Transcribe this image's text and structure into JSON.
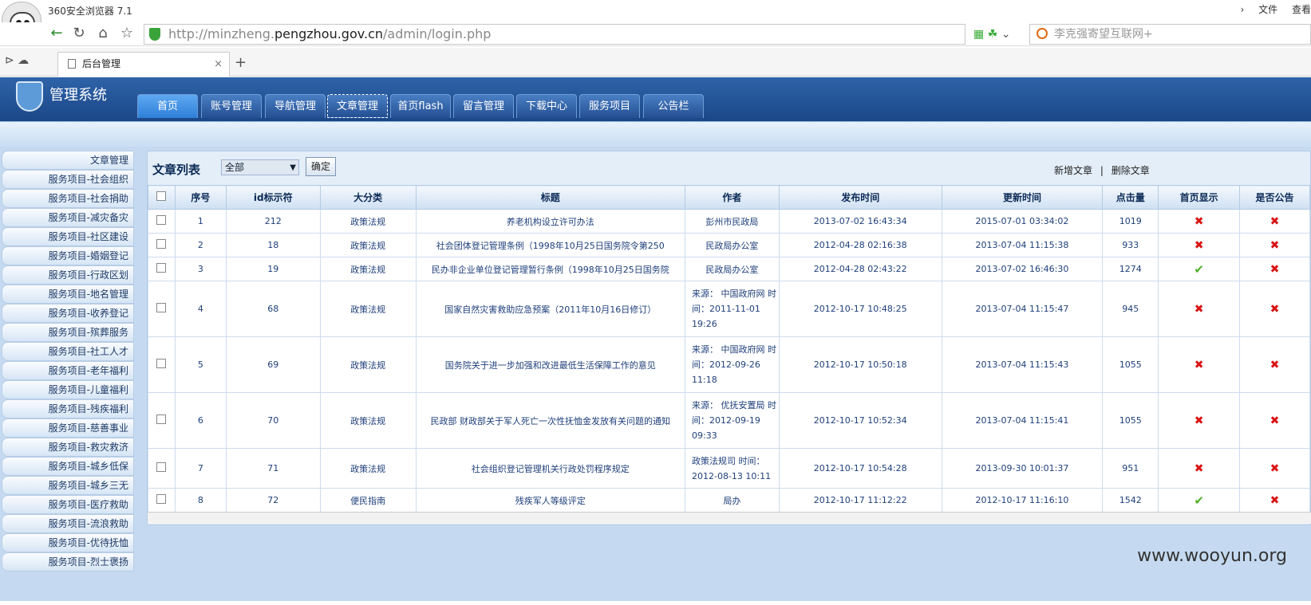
{
  "browser": {
    "app_title": "360安全浏览器 7.1",
    "menu": [
      "文件",
      "查看"
    ],
    "url_prefix": "http://minzheng.",
    "url_host": "pengzhou.gov.cn",
    "url_path": "/admin/login.php",
    "search_placeholder": "李克强寄望互联网+",
    "tab_title": "后台管理",
    "tab_close": "×",
    "new_tab": "+"
  },
  "header": {
    "system_name": "管理系统"
  },
  "nav_tabs": [
    "首页",
    "账号管理",
    "导航管理",
    "文章管理",
    "首页flash",
    "留言管理",
    "下载中心",
    "服务项目",
    "公告栏"
  ],
  "sidebar": [
    "文章管理",
    "服务项目-社会组织",
    "服务项目-社会捐助",
    "服务项目-减灾备灾",
    "服务项目-社区建设",
    "服务项目-婚姻登记",
    "服务项目-行政区划",
    "服务项目-地名管理",
    "服务项目-收养登记",
    "服务项目-殡葬服务",
    "服务项目-社工人才",
    "服务项目-老年福利",
    "服务项目-儿童福利",
    "服务项目-残疾福利",
    "服务项目-慈善事业",
    "服务项目-救灾救济",
    "服务项目-城乡低保",
    "服务项目-城乡三无",
    "服务项目-医疗救助",
    "服务项目-流浪救助",
    "服务项目-优待抚恤",
    "服务项目-烈士褒扬"
  ],
  "list": {
    "title": "文章列表",
    "category": "全部",
    "confirm": "确定",
    "add": "新增文章",
    "sep": "|",
    "delete": "删除文章"
  },
  "columns": [
    "序号",
    "id标示符",
    "大分类",
    "标题",
    "作者",
    "发布时间",
    "更新时间",
    "点击量",
    "首页显示",
    "是否公告"
  ],
  "rows": [
    {
      "n": "1",
      "id": "212",
      "cat": "政策法规",
      "title": "养老机构设立许可办法",
      "author": "彭州市民政局",
      "pub": "2013-07-02 16:43:34",
      "upd": "2015-07-01 03:34:02",
      "hits": "1019",
      "home": "x",
      "notice": "x"
    },
    {
      "n": "2",
      "id": "18",
      "cat": "政策法规",
      "title": "社会团体登记管理条例（1998年10月25日国务院令第250",
      "author": "民政局办公室",
      "pub": "2012-04-28 02:16:38",
      "upd": "2013-07-04 11:15:38",
      "hits": "933",
      "home": "x",
      "notice": "x"
    },
    {
      "n": "3",
      "id": "19",
      "cat": "政策法规",
      "title": "民办非企业单位登记管理暂行条例（1998年10月25日国务院",
      "author": "民政局办公室",
      "pub": "2012-04-28 02:43:22",
      "upd": "2013-07-02 16:46:30",
      "hits": "1274",
      "home": "ok",
      "notice": "x"
    },
    {
      "n": "4",
      "id": "68",
      "cat": "政策法规",
      "title": "国家自然灾害救助应急预案（2011年10月16日修订）",
      "author": "来源：  中国政府网 时间：2011-11-01 19:26",
      "pub": "2012-10-17 10:48:25",
      "upd": "2013-07-04 11:15:47",
      "hits": "945",
      "home": "x",
      "notice": "x"
    },
    {
      "n": "5",
      "id": "69",
      "cat": "政策法规",
      "title": "国务院关于进一步加强和改进最低生活保障工作的意见",
      "author": "来源：  中国政府网 时间：2012-09-26 11:18",
      "pub": "2012-10-17 10:50:18",
      "upd": "2013-07-04 11:15:43",
      "hits": "1055",
      "home": "x",
      "notice": "x"
    },
    {
      "n": "6",
      "id": "70",
      "cat": "政策法规",
      "title": "民政部 财政部关于军人死亡一次性抚恤金发放有关问题的通知",
      "author": "来源：  优抚安置局 时间：2012-09-19 09:33",
      "pub": "2012-10-17 10:52:34",
      "upd": "2013-07-04 11:15:41",
      "hits": "1055",
      "home": "x",
      "notice": "x"
    },
    {
      "n": "7",
      "id": "71",
      "cat": "政策法规",
      "title": "社会组织登记管理机关行政处罚程序规定",
      "author": "政策法规司 时间：2012-08-13 10:11",
      "pub": "2012-10-17 10:54:28",
      "upd": "2013-09-30 10:01:37",
      "hits": "951",
      "home": "x",
      "notice": "x"
    },
    {
      "n": "8",
      "id": "72",
      "cat": "便民指南",
      "title": "残疾军人等级评定",
      "author": "局办",
      "pub": "2012-10-17 11:12:22",
      "upd": "2012-10-17 11:16:10",
      "hits": "1542",
      "home": "ok",
      "notice": "x"
    }
  ],
  "watermark": "www.wooyun.org"
}
